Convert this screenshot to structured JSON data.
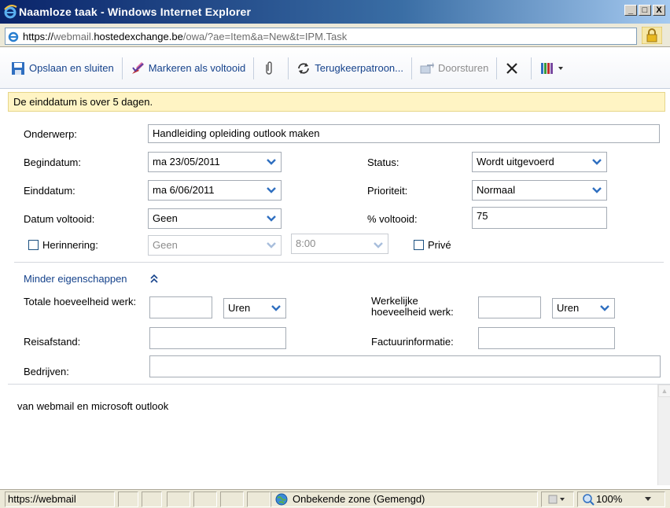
{
  "window": {
    "title": "Naamloze taak - Windows Internet Explorer",
    "controls": [
      "_",
      "□",
      "X"
    ]
  },
  "address": {
    "protocol": "https://",
    "prefix": "webmail.",
    "host": "hostedexchange.be",
    "path": "/owa/?ae=Item&a=New&t=IPM.Task"
  },
  "toolbar": {
    "save_close": "Opslaan en sluiten",
    "mark_complete": "Markeren als voltooid",
    "recurrence": "Terugkeerpatroon...",
    "forward": "Doorsturen"
  },
  "infobar": "De einddatum is over 5 dagen.",
  "form": {
    "subject_label": "Onderwerp:",
    "subject_value": "Handleiding opleiding outlook maken",
    "start_label": "Begindatum:",
    "start_value": "ma 23/05/2011",
    "due_label": "Einddatum:",
    "due_value": "ma 6/06/2011",
    "completed_label": "Datum voltooid:",
    "completed_value": "Geen",
    "reminder_label": "Herinnering:",
    "reminder_date": "Geen",
    "reminder_time": "8:00",
    "status_label": "Status:",
    "status_value": "Wordt uitgevoerd",
    "priority_label": "Prioriteit:",
    "priority_value": "Normaal",
    "percent_label": "% voltooid:",
    "percent_value": "75",
    "private_label": "Privé",
    "fewer_props": "Minder eigenschappen",
    "total_work_label": "Totale hoeveelheid werk:",
    "total_work_unit": "Uren",
    "actual_work_label": "Werkelijke hoeveelheid werk:",
    "actual_work_unit": "Uren",
    "mileage_label": "Reisafstand:",
    "billing_label": "Factuurinformatie:",
    "companies_label": "Bedrijven:"
  },
  "body_text": "van webmail en microsoft outlook",
  "statusbar": {
    "url": "https://webmail",
    "zone": "Onbekende zone (Gemengd)",
    "zoom": "100%"
  },
  "colors": {
    "link": "#15428b",
    "infobar_bg": "#fff4c4",
    "titlebar": "#0a246a"
  }
}
